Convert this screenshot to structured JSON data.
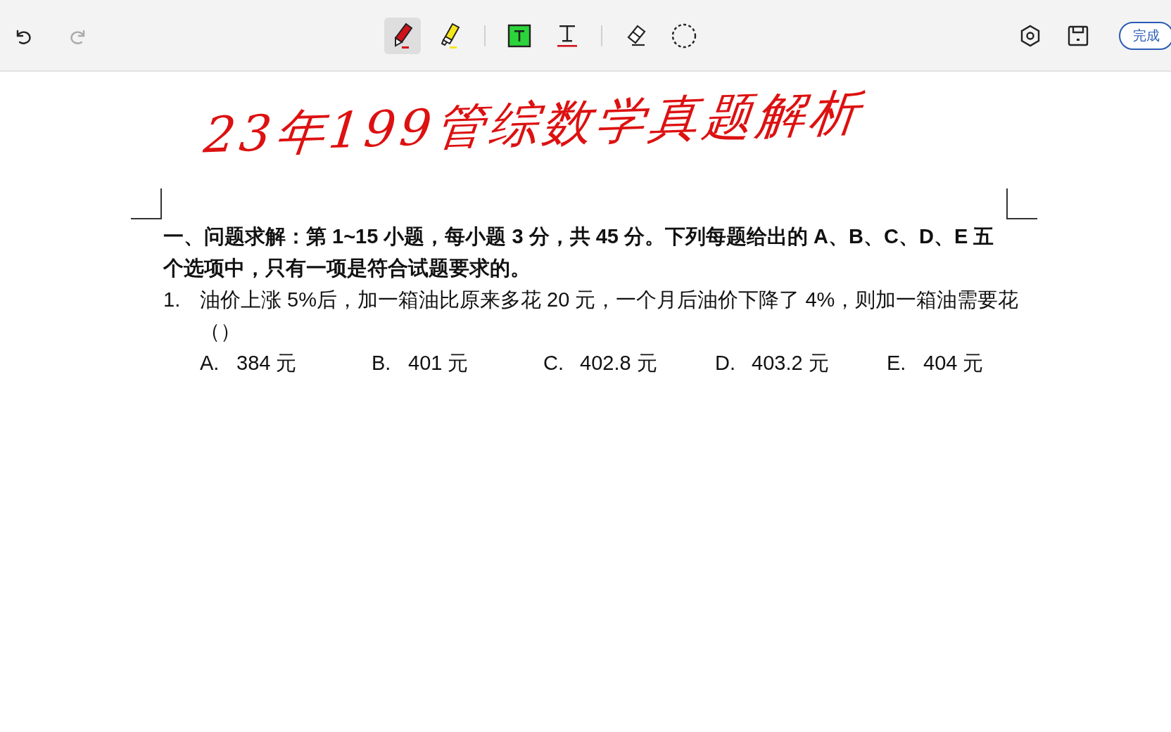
{
  "toolbar": {
    "history": [
      {
        "kind": "undo",
        "disabled": false
      },
      {
        "kind": "redo",
        "disabled": true
      }
    ],
    "tools": [
      {
        "kind": "pen",
        "selected": true
      },
      {
        "kind": "highlighter",
        "selected": false
      },
      {
        "kind": "divider"
      },
      {
        "kind": "textbox",
        "selected": false
      },
      {
        "kind": "text",
        "selected": false
      },
      {
        "kind": "divider"
      },
      {
        "kind": "eraser",
        "selected": false
      },
      {
        "kind": "lasso",
        "selected": false
      }
    ],
    "actions": [
      {
        "kind": "settings"
      },
      {
        "kind": "save"
      }
    ],
    "done_button": "完成"
  },
  "handwritten_title": "23年199管综数学真题解析",
  "document": {
    "section_heading": "一、问题求解：第 1~15 小题，每小题 3 分，共 45 分。下列每题给出的 A、B、C、D、E 五个选项中，只有一项是符合试题要求的。",
    "questions": [
      {
        "number": "1.",
        "text": "油价上涨 5%后，加一箱油比原来多花 20 元，一个月后油价下降了 4%，则加一箱油需要花（）",
        "options": [
          {
            "letter": "A.",
            "value": "384 元"
          },
          {
            "letter": "B.",
            "value": "401 元"
          },
          {
            "letter": "C.",
            "value": "402.8 元"
          },
          {
            "letter": "D.",
            "value": "403.2 元"
          },
          {
            "letter": "E.",
            "value": "404 元"
          }
        ]
      }
    ]
  }
}
